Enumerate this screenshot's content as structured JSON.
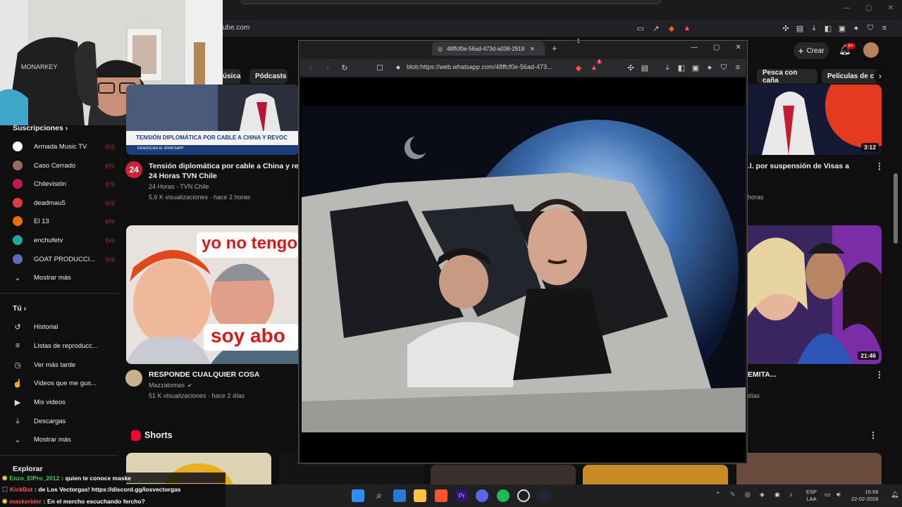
{
  "outer_browser": {
    "url_partial": "ube.com"
  },
  "youtube": {
    "crear_label": "Crear",
    "notif_badge": "9+",
    "chips": [
      "úsica",
      "Pódcasts",
      "Pesca con caña",
      "Películas de co"
    ],
    "sidebar": {
      "subs_title": "Suscripciones",
      "subs": [
        {
          "name": "Armada Music TV",
          "color": "#ffffff"
        },
        {
          "name": "Caso Cerrado",
          "color": "#9c6b5c"
        },
        {
          "name": "Chilevisión",
          "color": "#c2185b"
        },
        {
          "name": "deadmau5",
          "color": "#d93f3f"
        },
        {
          "name": "El 13",
          "color": "#ef6c00"
        },
        {
          "name": "enchufetv",
          "color": "#26a69a"
        },
        {
          "name": "GOAT PRODUCCI...",
          "color": "#5c6bc0"
        }
      ],
      "show_more": "Mostrar más",
      "you_title": "Tú",
      "you_items": [
        {
          "label": "Historial",
          "icon": "history-icon",
          "glyph": "↺"
        },
        {
          "label": "Listas de reproducc...",
          "icon": "playlist-icon",
          "glyph": "≡"
        },
        {
          "label": "Ver más tarde",
          "icon": "clock-icon",
          "glyph": "◷"
        },
        {
          "label": "Videos que me gus...",
          "icon": "thumbs-up-icon",
          "glyph": "👍"
        },
        {
          "label": "Mis videos",
          "icon": "my-videos-icon",
          "glyph": "▶"
        },
        {
          "label": "Descargas",
          "icon": "download-icon",
          "glyph": "⤓"
        }
      ],
      "show_more_2": "Mostrar más",
      "explore_title": "Explorar"
    },
    "videos": [
      {
        "title_line1": "Tensión diplomática por cable a China y revo",
        "title_line2": "24 Horas TVN Chile",
        "channel": "24 Horas - TVN Chile",
        "meta": "5,6 K visualizaciones · hace 2 horas",
        "thumb_banner": "TENSIÓN DIPLOMÁTICA POR CABLE A CHINA Y REVOC",
        "thumb_sub": "DENUNCIAS AL WHATSAPP",
        "channel_badge": "24"
      },
      {
        "title_line1": ".l. por suspensión de Visas a",
        "meta_partial": "horas",
        "duration": "3:12"
      },
      {
        "title_line1": "RESPONDE CUALQUIER COSA",
        "channel": "Mazzatomas",
        "meta": "51 K visualizaciones · hace 2 días",
        "thumb_text_top": "yo no tengo",
        "thumb_text_bottom": "soy abo"
      },
      {
        "title_line1": "EMITA...",
        "meta_partial": "días",
        "duration": "21:46"
      }
    ],
    "shorts_title": "Shorts"
  },
  "popup": {
    "tab_title": "48ffcf0e-56ad-473d-a036-2918",
    "url": "blob:https://web.whatsapp.com/48ffcf0e-56ad-473...",
    "ext_badge": "1"
  },
  "chat": [
    {
      "user": "Enzo_ElPro_2012",
      "user_color": "#39d353",
      "msg": ": quien te conoce maske"
    },
    {
      "user": "KickBot",
      "user_color": "#ff5555",
      "msg": ": de Los Vectorgas! https://discord.gg/losvectorgas"
    },
    {
      "user": "maskerider",
      "user_color": "#ff5555",
      "msg": ": En el mercho escuchando fercho?"
    }
  ],
  "taskbar": {
    "lang_line1": "ESP",
    "lang_line2": "LAA",
    "time": "15:58",
    "date": "22-02-2026"
  }
}
